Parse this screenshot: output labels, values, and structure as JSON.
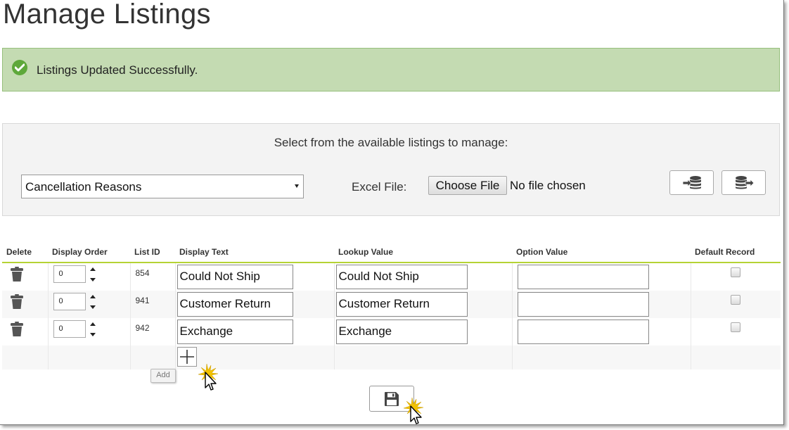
{
  "page": {
    "title": "Manage Listings"
  },
  "alert": {
    "message": "Listings Updated Successfully.",
    "icon": "check-circle-icon",
    "color": "#5ea83a"
  },
  "selector": {
    "prompt": "Select from the available listings to manage:",
    "selected_listing": "Cancellation Reasons",
    "excel_label": "Excel File:",
    "choose_file_label": "Choose File",
    "file_status": "No file chosen",
    "import_icon": "database-import-icon",
    "export_icon": "database-export-icon"
  },
  "table": {
    "headers": {
      "delete": "Delete",
      "display_order": "Display Order",
      "list_id": "List ID",
      "display_text": "Display Text",
      "lookup_value": "Lookup Value",
      "option_value": "Option Value",
      "default_record": "Default Record"
    },
    "rows": [
      {
        "display_order": "0",
        "list_id": "854",
        "display_text": "Could Not Ship",
        "lookup_value": "Could Not Ship",
        "option_value": "",
        "default": false
      },
      {
        "display_order": "0",
        "list_id": "941",
        "display_text": "Customer Return",
        "lookup_value": "Customer Return",
        "option_value": "",
        "default": false
      },
      {
        "display_order": "0",
        "list_id": "942",
        "display_text": "Exchange",
        "lookup_value": "Exchange",
        "option_value": "",
        "default": false
      }
    ],
    "accent_color": "#b5d334"
  },
  "add": {
    "tooltip": "Add",
    "icon": "plus-icon"
  },
  "save": {
    "icon": "floppy-disk-icon"
  }
}
